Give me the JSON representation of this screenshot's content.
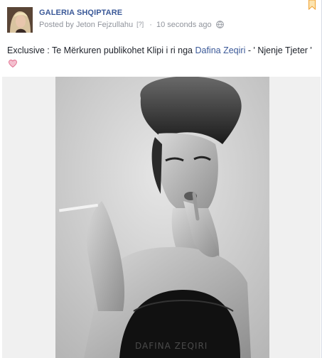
{
  "post": {
    "page_name": "GALERIA SHQIPTARE",
    "posted_by_prefix": "Posted by",
    "author": "Jeton Fejzullahu",
    "author_ref": "[?]",
    "separator": "·",
    "timestamp": "10 seconds ago",
    "privacy_icon": "globe-icon",
    "message_part1": "Exclusive : Te Mërkuren publikohet Klipi i ri nga ",
    "message_link": "Dafina Zeqiri",
    "message_part2": " - ' Njenje Tjeter ' ",
    "heart_icon": "heart-icon",
    "photo_watermark": "DAFINA ZEQIRI"
  },
  "colors": {
    "link": "#3b5998",
    "meta": "#90949c",
    "heart": "#e16b8c",
    "bookmark": "#f0a030"
  }
}
